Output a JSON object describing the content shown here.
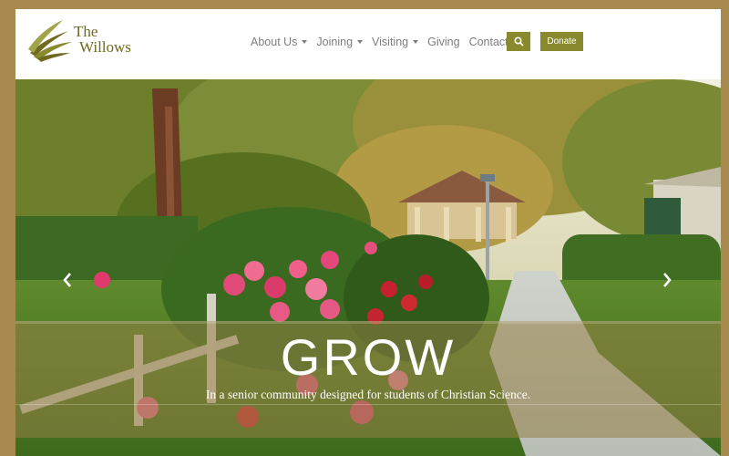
{
  "brand": {
    "line1": "The",
    "line2": "Willows",
    "color": "#6f6a1e"
  },
  "nav": {
    "items": [
      {
        "label": "About Us",
        "dropdown": true
      },
      {
        "label": "Joining",
        "dropdown": true
      },
      {
        "label": "Visiting",
        "dropdown": true
      },
      {
        "label": "Giving",
        "dropdown": false
      },
      {
        "label": "Contact Us",
        "dropdown": false
      }
    ],
    "search_icon": "search-icon",
    "donate_label": "Donate",
    "accent": "#898a2e"
  },
  "hero": {
    "title": "GROW",
    "subtitle": "In a senior community designed for students of Christian Science.",
    "prev_icon": "chevron-left-icon",
    "next_icon": "chevron-right-icon"
  },
  "page": {
    "border_color": "#a88a4e"
  }
}
